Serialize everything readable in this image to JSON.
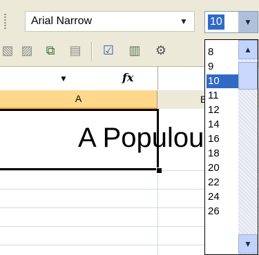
{
  "toolbar": {
    "font_name": "Arial Narrow",
    "font_size": "10",
    "icons": [
      "chart-icon",
      "copy-format-icon",
      "paste-icon",
      "spelling-icon",
      "research-icon",
      "autofilter-icon"
    ]
  },
  "formula_bar": {
    "fx_label": "fx",
    "name_box_arrow": "▼"
  },
  "columns": {
    "a": "A",
    "b": "B"
  },
  "cell_a1": "A Populou",
  "font_size_list": {
    "options": [
      "8",
      "9",
      "10",
      "11",
      "12",
      "14",
      "16",
      "18",
      "20",
      "22",
      "24",
      "26"
    ],
    "selected": "10"
  },
  "glyphs": {
    "down_arrow": "▼",
    "up_arrow": "▲"
  },
  "colors": {
    "selection": "#316ac5",
    "column_header_active": "#ffd88b",
    "window": "#ece9d8"
  }
}
